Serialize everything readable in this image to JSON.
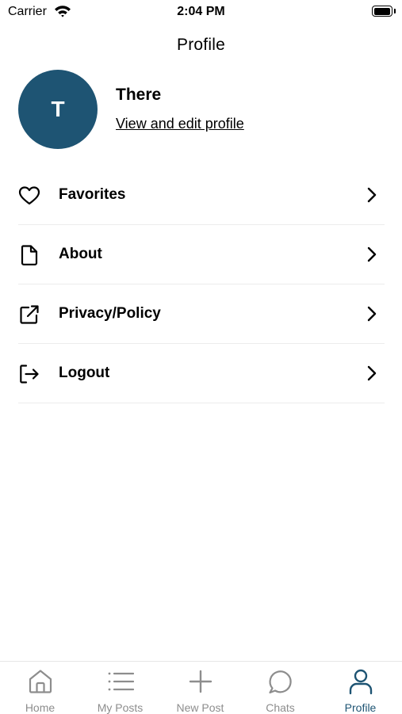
{
  "status_bar": {
    "carrier": "Carrier",
    "time": "2:04 PM"
  },
  "header": {
    "title": "Profile"
  },
  "profile": {
    "initial": "T",
    "name": "There",
    "edit_link": "View and edit profile",
    "avatar_color": "#1e5473"
  },
  "menu": {
    "items": [
      {
        "label": "Favorites",
        "icon": "heart-icon"
      },
      {
        "label": "About",
        "icon": "document-icon"
      },
      {
        "label": "Privacy/Policy",
        "icon": "external-link-icon"
      },
      {
        "label": "Logout",
        "icon": "logout-icon"
      }
    ]
  },
  "tab_bar": {
    "active_color": "#1e5473",
    "inactive_color": "#8d8d8d",
    "tabs": [
      {
        "label": "Home",
        "icon": "home-icon",
        "active": false
      },
      {
        "label": "My Posts",
        "icon": "list-icon",
        "active": false
      },
      {
        "label": "New Post",
        "icon": "plus-icon",
        "active": false
      },
      {
        "label": "Chats",
        "icon": "chat-icon",
        "active": false
      },
      {
        "label": "Profile",
        "icon": "person-icon",
        "active": true
      }
    ]
  }
}
